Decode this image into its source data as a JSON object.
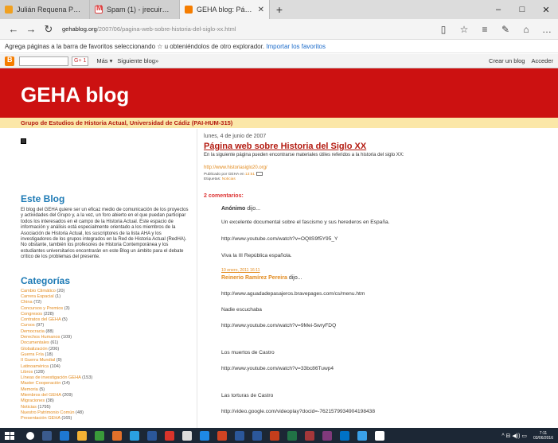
{
  "browser": {
    "tabs": [
      {
        "title": "Julián Requena Pérez, Auto",
        "favicon": "blogger-icon",
        "active": false
      },
      {
        "title": "Spam (1) - jrecuir@gmail.co",
        "favicon": "gmail-icon",
        "active": false
      },
      {
        "title": "GEHA blog: Página web",
        "favicon": "blogger-icon",
        "active": true
      }
    ],
    "new_tab": "+",
    "window_controls": {
      "minimize": "–",
      "maximize": "□",
      "close": "✕"
    },
    "url_domain": "gehablog.org",
    "url_path": "/2007/06/pagina-web-sobre-historia-del-siglo-xx.html",
    "nav": {
      "back": "←",
      "forward": "→",
      "refresh": "↻"
    },
    "right_icons": [
      "reading-view-icon",
      "favorite-star-icon",
      "hub-icon",
      "notes-icon",
      "share-icon",
      "more-icon"
    ],
    "favorites_hint": "Agrega páginas a la barra de favoritos seleccionando ☆ u obteniéndolos de otro explorador.",
    "favorites_link": "Importar los favoritos"
  },
  "blogger_bar": {
    "more": "Más ▾",
    "next": "Siguiente blog»",
    "create": "Crear un blog",
    "signin": "Acceder",
    "mini_button": "G+ 1"
  },
  "blog": {
    "title": "GEHA blog",
    "subtitle": "Grupo de Estudios de Historia Actual, Universidad de Cádiz (PAI-HUM-315)",
    "accent": "#cc1111",
    "band_color": "#fbe7a8"
  },
  "sidebar": {
    "about_title": "Este Blog",
    "about_text": "El blog del GEHA quiere ser un eficaz medio de comunicación de los proyectos y actividades del Grupo y, a la vez, un foro abierto en el que puedan participar todos los interesados en el campo de la Historia Actual. Este espacio de información y análisis está especialmente orientado a los miembros de la Asociación de Historia Actual, los suscriptores de la lista AHA y los investigadores de los grupos integrados en la Red de Historia Actual (RedHA). No obstante, también los profesores de Historia Contemporánea y los estudiantes universitarios encontrarán en este Blog un ámbito para el debate crítico de los problemas del presente.",
    "categories_title": "Categorías",
    "categories": [
      {
        "name": "Cambio Climático",
        "count": "(20)"
      },
      {
        "name": "Carrera Espacial",
        "count": "(1)"
      },
      {
        "name": "China",
        "count": "(72)"
      },
      {
        "name": "Concursos y Premios",
        "count": "(3)"
      },
      {
        "name": "Congresos",
        "count": "(228)"
      },
      {
        "name": "Contratos del GEHA",
        "count": "(5)"
      },
      {
        "name": "Cursos",
        "count": "(97)"
      },
      {
        "name": "Democracia",
        "count": "(88)"
      },
      {
        "name": "Derechos Humanos",
        "count": "(109)"
      },
      {
        "name": "Documentales",
        "count": "(61)"
      },
      {
        "name": "Globalización",
        "count": "(206)"
      },
      {
        "name": "Guerra Fría",
        "count": "(18)"
      },
      {
        "name": "II Guerra Mundial",
        "count": "(9)"
      },
      {
        "name": "Latinoamérica",
        "count": "(104)"
      },
      {
        "name": "Libros",
        "count": "(128)"
      },
      {
        "name": "Líneas de investigación GEHA",
        "count": "(153)"
      },
      {
        "name": "Master Cooperación",
        "count": "(14)"
      },
      {
        "name": "Memoria",
        "count": "(5)"
      },
      {
        "name": "Miembros del GEHA",
        "count": "(209)"
      },
      {
        "name": "Migraciones",
        "count": "(38)"
      },
      {
        "name": "Noticias",
        "count": "(1795)"
      },
      {
        "name": "Nuestro Patrimonio Común",
        "count": "(48)"
      },
      {
        "name": "Presentación GEHA",
        "count": "(165)"
      }
    ]
  },
  "post": {
    "date": "lunes, 4 de junio de 2007",
    "title": "Página web sobre Historia del Siglo XX",
    "description": "En la siguiente página pueden encontrarse materiales útiles referidos a la historia del siglo XX:",
    "link": "http://www.historiasiglo20.org/",
    "meta_published": "Publicado por GEHA en",
    "meta_time": "13:51",
    "meta_labels_prefix": "Etiquetas:",
    "meta_label": "Noticias",
    "comments_heading": "2 comentarios:",
    "comment1_author": "Anónimo",
    "comment1_said": "dijo...",
    "comment1_lines": [
      "Un excelente documental sobre el fascismo y sus herederos en España.",
      "http://www.youtube.com/watch?v=OQllS9f5Y95_Y",
      "Viva la III República española."
    ],
    "comment1_time": "10 enero, 2011 16:11",
    "comment2_author": "Reinerio Ramírez Pereira",
    "comment2_said": "dijo...",
    "comment2_lines": [
      "http://www.aguadadepasajeros.bravepages.com/cs/menu.htm",
      "Nadie escuchaba",
      "http://www.youtube.com/watch?v=9Mei-5wryFDQ",
      "Los muertos de Castro",
      "http://www.youtube.com/watch?v=33bc86Tuwp4",
      "Las torturas de Castro",
      "http://video.google.com/videoplay?docid=-7621579934904198438"
    ]
  },
  "taskbar": {
    "time": "7:11",
    "date": "03/06/2016",
    "tray": "^ ⊟ ◀)) ▭"
  }
}
